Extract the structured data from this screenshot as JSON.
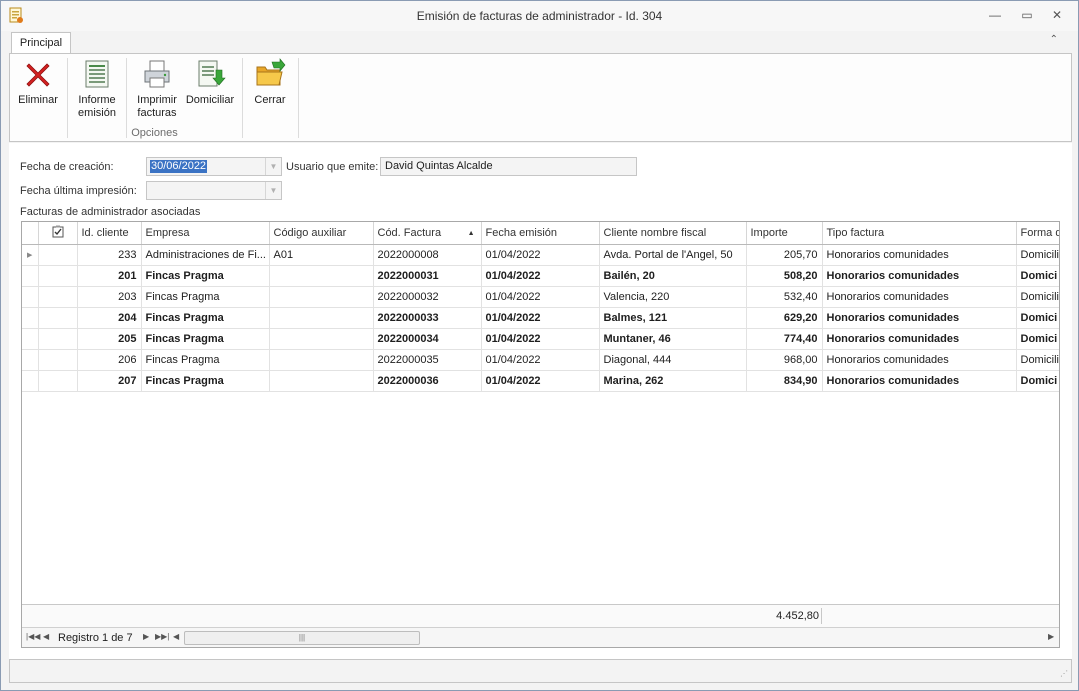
{
  "window": {
    "title": "Emisión de facturas de administrador - Id. 304",
    "minimize_glyph": "—",
    "restore_glyph": "▭",
    "close_glyph": "✕"
  },
  "ribbon": {
    "tab_label": "Principal",
    "collapse_glyph": "⌃",
    "buttons": {
      "eliminar": "Eliminar",
      "informe_line1": "Informe",
      "informe_line2": "emisión",
      "imprimir_line1": "Imprimir",
      "imprimir_line2": "facturas",
      "domiciliar": "Domiciliar",
      "cerrar": "Cerrar"
    },
    "group_label": "Opciones"
  },
  "form": {
    "fecha_creacion_label": "Fecha de creación:",
    "fecha_creacion_value": "30/06/2022",
    "usuario_label": "Usuario que emite:",
    "usuario_value": "David Quintas Alcalde",
    "fecha_impresion_label": "Fecha última impresión:",
    "fecha_impresion_value": "",
    "facturas_label": "Facturas de administrador asociadas"
  },
  "grid": {
    "columns": [
      "Id. cliente",
      "Empresa",
      "Código auxiliar",
      "Cód. Factura",
      "Fecha emisión",
      "Cliente nombre fiscal",
      "Importe",
      "Tipo factura",
      "Forma d"
    ],
    "rows": [
      {
        "bold": false,
        "current": true,
        "id": "233",
        "empresa": "Administraciones de Fi...",
        "aux": "A01",
        "factura": "2022000008",
        "fecha": "01/04/2022",
        "cliente": "Avda. Portal de l'Angel, 50",
        "importe": "205,70",
        "tipo": "Honorarios comunidades",
        "forma": "Domicilia"
      },
      {
        "bold": true,
        "current": false,
        "id": "201",
        "empresa": "Fincas Pragma",
        "aux": "",
        "factura": "2022000031",
        "fecha": "01/04/2022",
        "cliente": "Bailén, 20",
        "importe": "508,20",
        "tipo": "Honorarios comunidades",
        "forma": "Domici"
      },
      {
        "bold": false,
        "current": false,
        "id": "203",
        "empresa": "Fincas Pragma",
        "aux": "",
        "factura": "2022000032",
        "fecha": "01/04/2022",
        "cliente": "Valencia, 220",
        "importe": "532,40",
        "tipo": "Honorarios comunidades",
        "forma": "Domicilia"
      },
      {
        "bold": true,
        "current": false,
        "id": "204",
        "empresa": "Fincas Pragma",
        "aux": "",
        "factura": "2022000033",
        "fecha": "01/04/2022",
        "cliente": "Balmes, 121",
        "importe": "629,20",
        "tipo": "Honorarios comunidades",
        "forma": "Domici"
      },
      {
        "bold": true,
        "current": false,
        "id": "205",
        "empresa": "Fincas Pragma",
        "aux": "",
        "factura": "2022000034",
        "fecha": "01/04/2022",
        "cliente": "Muntaner, 46",
        "importe": "774,40",
        "tipo": "Honorarios comunidades",
        "forma": "Domici"
      },
      {
        "bold": false,
        "current": false,
        "id": "206",
        "empresa": "Fincas Pragma",
        "aux": "",
        "factura": "2022000035",
        "fecha": "01/04/2022",
        "cliente": "Diagonal, 444",
        "importe": "968,00",
        "tipo": "Honorarios comunidades",
        "forma": "Domicilia"
      },
      {
        "bold": true,
        "current": false,
        "id": "207",
        "empresa": "Fincas Pragma",
        "aux": "",
        "factura": "2022000036",
        "fecha": "01/04/2022",
        "cliente": "Marina, 262",
        "importe": "834,90",
        "tipo": "Honorarios comunidades",
        "forma": "Domici"
      }
    ],
    "total_importe": "4.452,80",
    "navigator_text": "Registro 1 de 7"
  },
  "icons": {
    "app": "invoice-app-icon",
    "eliminar": "red-x-icon",
    "informe": "spreadsheet-report-icon",
    "imprimir": "printer-icon",
    "domiciliar": "document-download-icon",
    "cerrar": "folder-arrow-icon",
    "check_header": "checkbox-header-icon"
  },
  "colors": {
    "selection": "#3b73c4",
    "eliminar_red": "#d42121",
    "cerrar_folder": "#f2b631",
    "cerrar_arrow": "#3aa63a"
  }
}
